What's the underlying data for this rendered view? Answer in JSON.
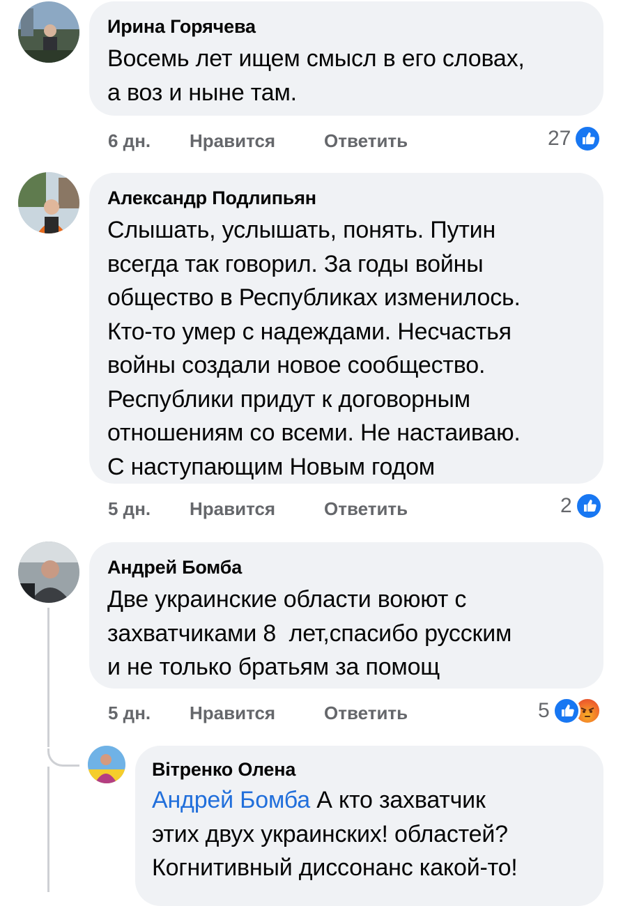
{
  "comments": [
    {
      "author": "Ирина Горячева",
      "lines": [
        "Восемь лет ищем смысл в его словах,",
        "а воз и ныне там."
      ],
      "time": "6 дн.",
      "like": "Нравится",
      "reply": "Ответить",
      "reactions": "27"
    },
    {
      "author": "Александр Подлипьян",
      "lines": [
        "Слышать, услышать, понять. Путин",
        "всегда так говорил. За годы войны",
        "общество в Республиках изменилось.",
        "Кто-то умер с надеждами. Несчастья",
        "войны создали новое сообщество.",
        "Республики придут к договорным",
        "отношениям со всеми. Не настаиваю.",
        "С наступающим Новым годом"
      ],
      "time": "5 дн.",
      "like": "Нравится",
      "reply": "Ответить",
      "reactions": "2"
    },
    {
      "author": "Андрей Бомба",
      "lines": [
        "Две украинские области воюют с",
        "захватчиками 8  лет,спасибо русским",
        "и не только братьям за помощ"
      ],
      "time": "5 дн.",
      "like": "Нравится",
      "reply": "Ответить",
      "reactions": "5"
    }
  ],
  "reply": {
    "author": "Вітренко Олена",
    "mention": "Андрей Бомба",
    "line1_rest": " А кто захватчик",
    "line2": "этих двух украинских! областей?",
    "line3": "Когнитивный диссонанс какой-то!"
  },
  "colors": {
    "bubble": "#f0f2f5",
    "meta": "#65676b",
    "mention": "#216fdb",
    "like": "#1877f2"
  },
  "icons": [
    "like-reaction-icon",
    "angry-reaction-icon",
    "avatar"
  ]
}
